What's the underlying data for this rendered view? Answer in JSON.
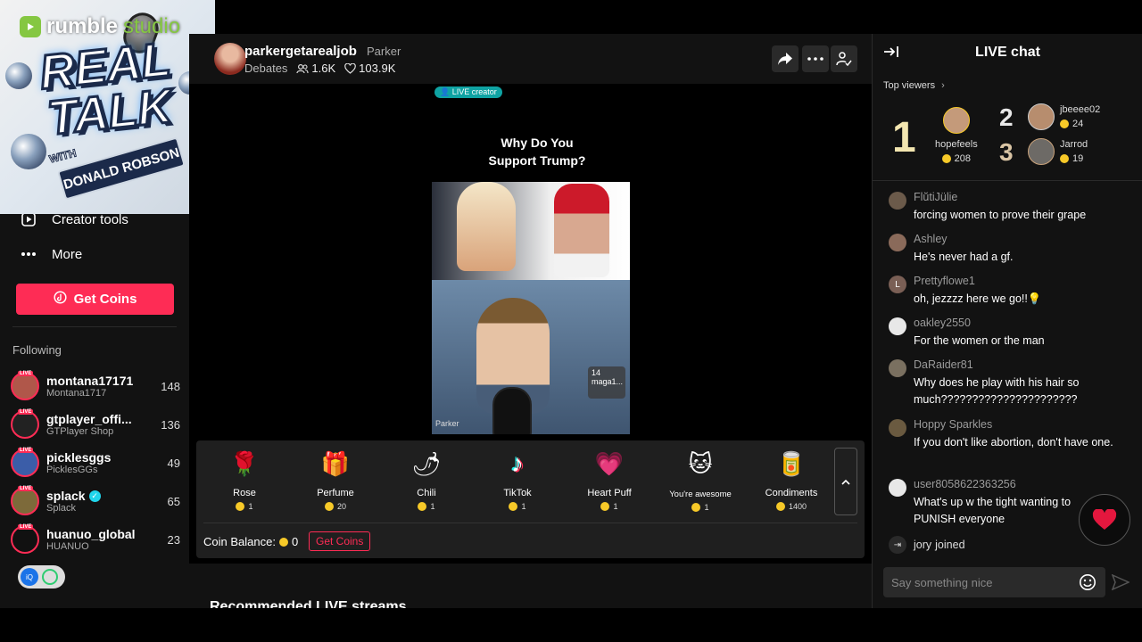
{
  "logo": {
    "brand": "rumble",
    "brand_suffix": "studio",
    "title": "REAL TALK",
    "with": "WITH",
    "name": "DONALD ROBSON"
  },
  "sidebar": {
    "nav": [
      {
        "label": "Creator tools",
        "icon": "creator-tools-icon"
      },
      {
        "label": "More",
        "icon": "more-dots-icon"
      }
    ],
    "get_coins_label": "Get Coins",
    "following_label": "Following",
    "following": [
      {
        "name": "montana17171",
        "sub": "Montana1717",
        "count": "148",
        "verified": false,
        "live": "LIVE",
        "color": "#b0574a"
      },
      {
        "name": "gtplayer_offi...",
        "sub": "GTPlayer Shop",
        "count": "136",
        "verified": false,
        "live": "LIVE",
        "color": "#222222"
      },
      {
        "name": "picklesggs",
        "sub": "PicklesGGs",
        "count": "49",
        "verified": false,
        "live": "LIVE",
        "color": "#3b5da8"
      },
      {
        "name": "splack",
        "sub": "Splack",
        "count": "65",
        "verified": true,
        "live": "LIVE",
        "color": "#7d6a3a"
      },
      {
        "name": "huanuo_global",
        "sub": "HUANUO",
        "count": "23",
        "verified": false,
        "live": "LIVE",
        "color": "#111111"
      }
    ]
  },
  "stream": {
    "username": "parkergetarealjob",
    "nickname": "Parker",
    "category": "Debates",
    "viewers": "1.6K",
    "likes": "103.9K",
    "live_creator_badge": "LIVE creator",
    "video_title_line1": "Why Do You",
    "video_title_line2": "Support Trump?",
    "watermark": "Parker",
    "viewer_badge_count": "14",
    "viewer_badge_name": "maga1..."
  },
  "gifts": [
    {
      "name": "Rose",
      "price": "1",
      "icon": "rose-icon",
      "glyph": "🌹"
    },
    {
      "name": "Perfume",
      "price": "20",
      "icon": "perfume-icon",
      "glyph": "🎁"
    },
    {
      "name": "Chili",
      "price": "1",
      "icon": "chili-icon",
      "glyph": "🌶"
    },
    {
      "name": "TikTok",
      "price": "1",
      "icon": "tiktok-icon",
      "glyph": "♪"
    },
    {
      "name": "Heart Puff",
      "price": "1",
      "icon": "heart-puff-icon",
      "glyph": "💗"
    },
    {
      "name": "You're awesome",
      "price": "1",
      "icon": "cat-icon",
      "glyph": "🐱"
    },
    {
      "name": "Condiments",
      "price": "1400",
      "icon": "condiments-icon",
      "glyph": "🥫"
    }
  ],
  "wallet": {
    "label": "Coin Balance:",
    "balance": "0",
    "get_coins_label": "Get Coins"
  },
  "recommended_label": "Recommended LIVE streams",
  "chat": {
    "title": "LIVE chat",
    "top_viewers_label": "Top viewers",
    "top_viewers": [
      {
        "rank": "1",
        "name": "hopefeels",
        "points": "208"
      },
      {
        "rank": "2",
        "name": "jbeeee02",
        "points": "24"
      },
      {
        "rank": "3",
        "name": "Jarrod",
        "points": "19"
      }
    ],
    "messages": [
      {
        "user": "FlŭtiJülie",
        "text": "forcing women to prove their grape",
        "avatar_color": "#6b5a4a",
        "initial": ""
      },
      {
        "user": "Ashley",
        "text": "He's never had a gf.",
        "avatar_color": "#8a6a5a",
        "initial": ""
      },
      {
        "user": "Prettyflowe1",
        "text": "oh, jezzzz here we go!!💡",
        "avatar_color": "#7a5f55",
        "initial": "L"
      },
      {
        "user": "oakley2550",
        "text": "For the women or the man",
        "avatar_color": "#e8e8e8",
        "initial": ""
      },
      {
        "user": "DaRaider81",
        "text": "Why does he play with his hair so much??????????????????????",
        "avatar_color": "#7a7060",
        "initial": ""
      },
      {
        "user": "Hoppy Sparkles",
        "text": "If you don't like abortion, don't have one.",
        "avatar_color": "#6a5a40",
        "initial": ""
      },
      {
        "user": "user8058622363256",
        "text": "What's up w the tight wanting to PUNISH everyone",
        "avatar_color": "#e8e8e8",
        "initial": ""
      }
    ],
    "joined_user": "jory",
    "joined_text": "joined",
    "input_placeholder": "Say something nice"
  },
  "colors": {
    "accent": "#fe2c55",
    "coin": "#f7c928",
    "live_teal": "#0fa3a3",
    "brand_green": "#85c742"
  }
}
